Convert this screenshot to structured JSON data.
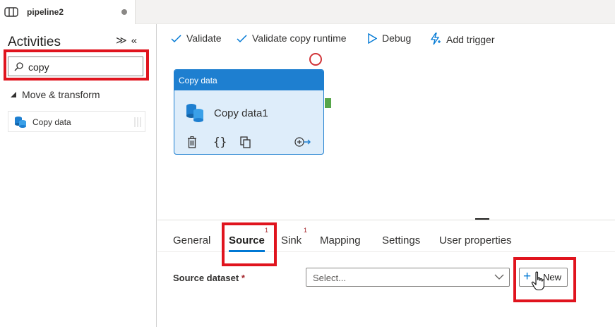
{
  "tab": {
    "title": "pipeline2",
    "icon": "pipeline-icon",
    "unsaved_dot": "unsaved-dot"
  },
  "sidebar": {
    "title": "Activities",
    "collapse_icons": "collapse-all-icon, hide-pane-icon",
    "search": {
      "value": "copy",
      "icon": "search-icon"
    },
    "section": "Move & transform",
    "items": [
      {
        "label": "Copy data",
        "icon": "copy-data-icon"
      }
    ]
  },
  "toolbar": {
    "validate": "Validate",
    "validate_runtime": "Validate copy runtime",
    "debug": "Debug",
    "add_trigger": "Add trigger"
  },
  "canvas": {
    "node": {
      "type_label": "Copy data",
      "name": "Copy data1",
      "actions": [
        "delete-icon",
        "code-icon",
        "clone-icon",
        "add-output-icon"
      ],
      "code_glyph": "{}"
    },
    "status_color": "#d13438",
    "port_color": "#57a64a"
  },
  "properties": {
    "tabs": [
      {
        "label": "General"
      },
      {
        "label": "Source",
        "badge": "1",
        "active": true
      },
      {
        "label": "Sink",
        "badge": "1"
      },
      {
        "label": "Mapping"
      },
      {
        "label": "Settings"
      },
      {
        "label": "User properties"
      }
    ],
    "source_dataset": {
      "label": "Source dataset",
      "required_mark": "*",
      "placeholder": "Select...",
      "new_button": "New"
    }
  },
  "colors": {
    "accent": "#0078d4",
    "node_header": "#1e7fd0",
    "node_body": "#deedfa",
    "highlight": "#e0141e"
  }
}
